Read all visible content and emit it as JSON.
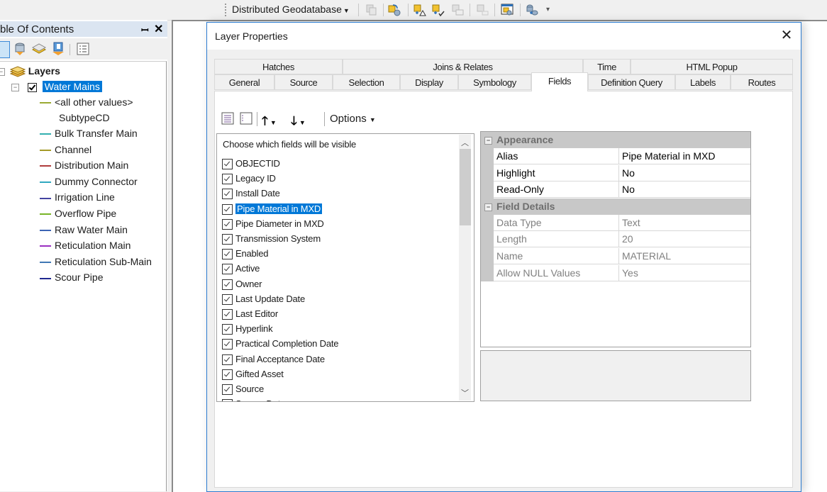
{
  "toolbar": {
    "dropdown_label": "Distributed Geodatabase",
    "icons": [
      "copy-data-icon",
      "extract-data-icon",
      "create-replica-icon",
      "synchronize-changes-icon",
      "import-message-icon",
      "export-message-icon",
      "replica-manager-icon",
      "check-in-icon"
    ],
    "overflow": "toolbar-overflow-icon"
  },
  "toc": {
    "title": "ble Of Contents",
    "pin_glyph": "⊥",
    "close_glyph": "✕",
    "tools": [
      "list-by-drawing-order-icon",
      "list-by-source-icon",
      "list-by-visibility-icon",
      "list-by-selection-icon",
      "options-icon"
    ],
    "root_label": "Layers",
    "layer_label": "Water Mains",
    "layer_checked": true,
    "default_item": {
      "label": "<all other values>",
      "color": "#9aaa32"
    },
    "heading": "SubtypeCD",
    "legend": [
      {
        "label": "Bulk Transfer Main",
        "color": "#33b0b0"
      },
      {
        "label": "Channel",
        "color": "#a59a28"
      },
      {
        "label": "Distribution Main",
        "color": "#b03c3c"
      },
      {
        "label": "Dummy Connector",
        "color": "#30a8c0"
      },
      {
        "label": "Irrigation Line",
        "color": "#4444a0"
      },
      {
        "label": "Overflow Pipe",
        "color": "#78b428"
      },
      {
        "label": "Raw Water Main",
        "color": "#3c64b4"
      },
      {
        "label": "Reticulation Main",
        "color": "#9a30c0"
      },
      {
        "label": "Reticulation Sub-Main",
        "color": "#4078b4"
      },
      {
        "label": "Scour Pipe",
        "color": "#202890"
      }
    ]
  },
  "dialog": {
    "title": "Layer Properties",
    "close_glyph": "✕",
    "tabs_row1": [
      "Hatches",
      "Joins & Relates",
      "Time",
      "HTML Popup"
    ],
    "tabs_row2": [
      "General",
      "Source",
      "Selection",
      "Display",
      "Symbology",
      "Fields",
      "Definition Query",
      "Labels",
      "Routes"
    ],
    "active_tab": "Fields",
    "fields_toolbar": {
      "icons": [
        "table-view-icon",
        "list-view-icon",
        "move-up-icon",
        "move-down-icon"
      ],
      "options_label": "Options"
    },
    "field_list": {
      "header": "Choose which fields will be visible",
      "selected": "Pipe Material in MXD",
      "items": [
        {
          "label": "OBJECTID",
          "checked": true
        },
        {
          "label": "Legacy ID",
          "checked": true
        },
        {
          "label": "Install Date",
          "checked": true
        },
        {
          "label": "Pipe Material in MXD",
          "checked": true
        },
        {
          "label": "Pipe Diameter in MXD",
          "checked": true
        },
        {
          "label": "Transmission System",
          "checked": true
        },
        {
          "label": "Enabled",
          "checked": true
        },
        {
          "label": "Active",
          "checked": true
        },
        {
          "label": "Owner",
          "checked": true
        },
        {
          "label": "Last Update Date",
          "checked": true
        },
        {
          "label": "Last Editor",
          "checked": true
        },
        {
          "label": "Hyperlink",
          "checked": true
        },
        {
          "label": "Practical Completion Date",
          "checked": true
        },
        {
          "label": "Final Acceptance Date",
          "checked": true
        },
        {
          "label": "Gifted Asset",
          "checked": true
        },
        {
          "label": "Source",
          "checked": true
        },
        {
          "label": "Source Date",
          "checked": true
        }
      ]
    },
    "property_grid": {
      "categories": [
        {
          "name": "Appearance",
          "rows": [
            {
              "name": "Alias",
              "value": "Pipe Material in MXD",
              "readonly": false
            },
            {
              "name": "Highlight",
              "value": "No",
              "readonly": false
            },
            {
              "name": "Read-Only",
              "value": "No",
              "readonly": false
            }
          ]
        },
        {
          "name": "Field Details",
          "rows": [
            {
              "name": "Data Type",
              "value": "Text",
              "readonly": true
            },
            {
              "name": "Length",
              "value": "20",
              "readonly": true
            },
            {
              "name": "Name",
              "value": "MATERIAL",
              "readonly": true
            },
            {
              "name": "Allow NULL Values",
              "value": "Yes",
              "readonly": true
            }
          ]
        }
      ]
    },
    "description": ""
  }
}
